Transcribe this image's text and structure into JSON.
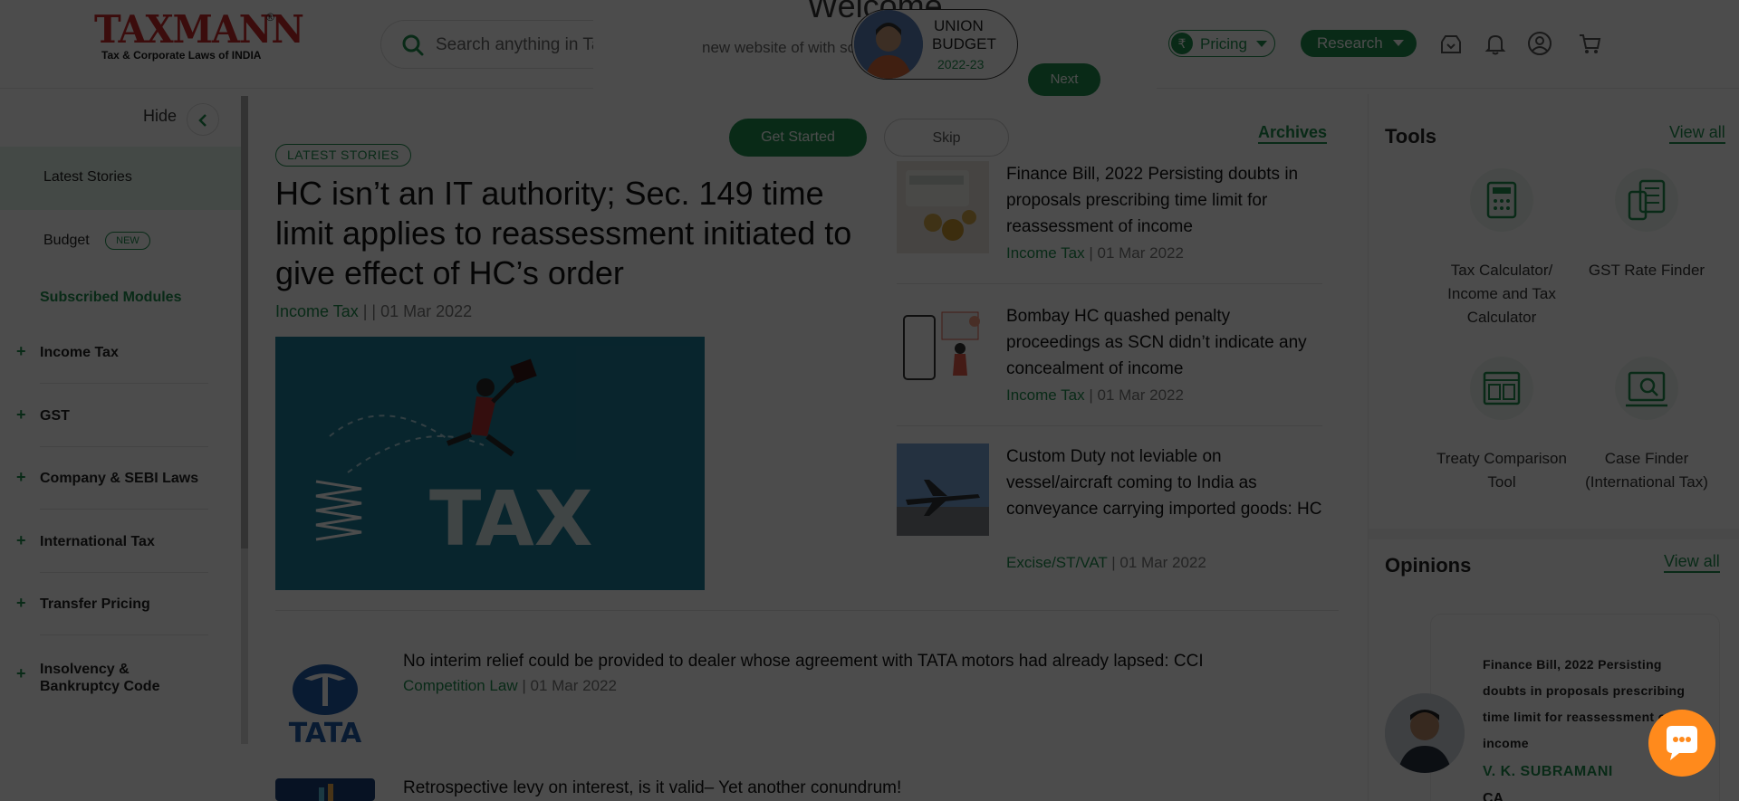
{
  "header": {
    "logo_word": "TAXMANN",
    "logo_reg": "®",
    "logo_tagline": "Tax & Corporate Laws of INDIA",
    "search_placeholder": "Search anything in Taxmann Research",
    "budget_badge": {
      "line1": "UNION",
      "line2": "BUDGET",
      "year": "2022-23"
    },
    "pricing_label": "Pricing",
    "pricing_symbol": "₹",
    "research_label": "Research",
    "icons": [
      "download-tray-icon",
      "bell-icon",
      "user-circle-icon",
      "cart-icon"
    ]
  },
  "welcome_modal": {
    "title": "Welcome",
    "text": "new website of                    with some new features",
    "next_label": "Next",
    "start_label": "Get Started",
    "skip_label": "Skip"
  },
  "sidebar": {
    "hide_label": "Hide",
    "latest_label": "Latest Stories",
    "budget_label": "Budget",
    "budget_badge": "NEW",
    "subscribed_label": "Subscribed Modules",
    "modules": [
      "Income Tax",
      "GST",
      "Company & SEBI Laws",
      "International Tax",
      "Transfer Pricing",
      "Insolvency & Bankruptcy Code"
    ]
  },
  "main": {
    "tag": "LATEST STORIES",
    "headline": "HC isn’t an IT authority; Sec. 149 time limit applies to reassessment initiated to give effect of HC’s order",
    "category": "Income Tax",
    "date": "| | 01 Mar 2022",
    "hero_text": "TAX",
    "archives_label": "Archives",
    "side_stories": [
      {
        "title": "Finance Bill, 2022 Persisting doubts in proposals prescribing time limit for reassessment of income",
        "category": "Income Tax",
        "date": "| 01 Mar 2022"
      },
      {
        "title": "Bombay HC quashed penalty proceedings as SCN didn’t indicate any concealment of income",
        "category": "Income Tax",
        "date": "| 01 Mar 2022"
      },
      {
        "title": "Custom Duty not leviable on vessel/aircraft coming to India as conveyance carrying imported goods: HC",
        "category": "Excise/ST/VAT",
        "date": "| 01 Mar 2022"
      }
    ],
    "list_stories": [
      {
        "title": "No interim relief could be provided to dealer whose agreement with TATA motors had already lapsed: CCI",
        "category": "Competition Law",
        "date": "| 01 Mar 2022",
        "logo_text": "TATA"
      },
      {
        "title": "Retrospective levy on interest, is it valid– Yet another conundrum!"
      }
    ]
  },
  "right_panel": {
    "tools_title": "Tools",
    "view_all": "View all",
    "tools": [
      {
        "label": "Tax Calculator/ Income and Tax Calculator",
        "icon": "calculator-icon"
      },
      {
        "label": "GST Rate Finder",
        "icon": "gst-calculator-icon"
      },
      {
        "label": "Treaty Comparison Tool",
        "icon": "treaty-compare-icon"
      },
      {
        "label": "Case Finder (International Tax)",
        "icon": "case-finder-icon"
      }
    ],
    "opinions_title": "Opinions",
    "opinion": {
      "text": "Finance Bill, 2022 Persisting doubts in proposals prescribing time limit for reassessment of income",
      "author": "V. K. SUBRAMANI",
      "extra": "CA"
    }
  },
  "colors": {
    "brand_green": "#1e8e4e",
    "logo_red": "#c62828",
    "chat_orange": "#ff8a1c",
    "overlay": "rgba(0,0,0,0.7)"
  }
}
